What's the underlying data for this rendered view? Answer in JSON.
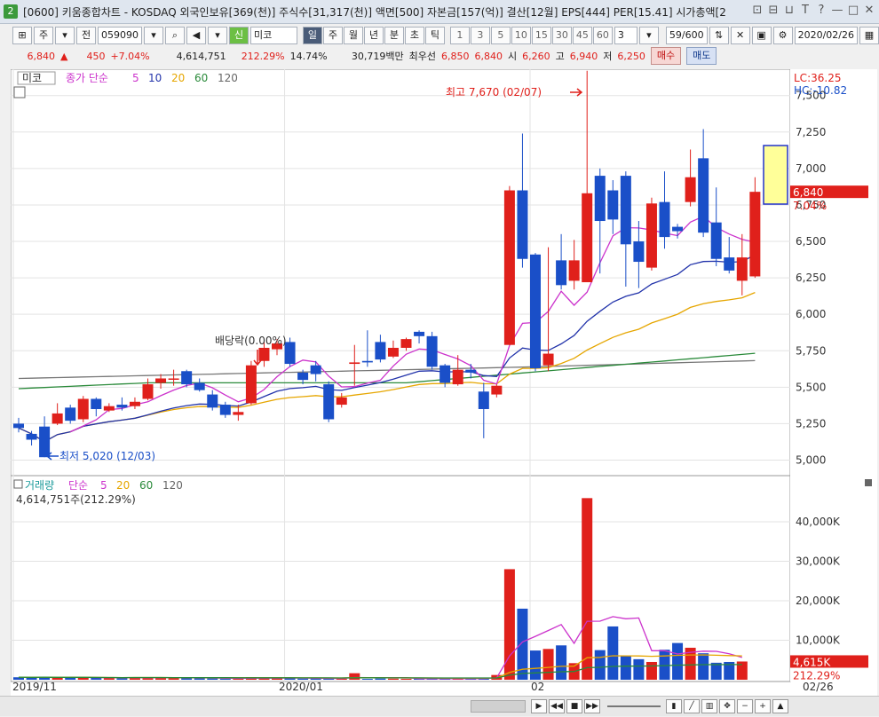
{
  "window": {
    "number": "2",
    "title": "[0600] 키움종합차트 - KOSDAQ 외국인보유[369(천)] 주식수[31,317(천)] 액면[500] 자본금[157(억)] 결산[12월] EPS[444] PER[15.41] 시가총액[2",
    "controls": [
      "⊡",
      "⊟",
      "⊔",
      "T",
      "?",
      "—",
      "□",
      "✕"
    ]
  },
  "toolbar": {
    "kind": "주",
    "prev_label": "전",
    "code": "059090",
    "credit_label": "신",
    "name": "미코",
    "periods": [
      "일",
      "주",
      "월",
      "년",
      "분",
      "초",
      "틱"
    ],
    "period_selected": "일",
    "intervals": [
      "1",
      "3",
      "5",
      "10",
      "15",
      "30",
      "45",
      "60"
    ],
    "interval_value": "3",
    "count": "59/600",
    "date": "2020/02/26"
  },
  "quote": {
    "price": "6,840",
    "arrow": "▲",
    "change": "450",
    "change_pct": "+7.04%",
    "volume": "4,614,751",
    "volume_ratio": "212.29%",
    "turnover": "14.74%",
    "amount": "30,719백만",
    "best_ask_label": "최우선",
    "best_ask": "6,850",
    "best_bid": "6,840",
    "open_label": "시",
    "open": "6,260",
    "high_label": "고",
    "high": "6,940",
    "low_label": "저",
    "low": "6,250",
    "buy_label": "매수",
    "sell_label": "매도"
  },
  "price_panel": {
    "name_tag": "미코",
    "legend": [
      "종가 단순",
      "5",
      "10",
      "20",
      "60",
      "120"
    ],
    "legend_colors": [
      "#cc33cc",
      "#cc33cc",
      "#2233aa",
      "#e6a600",
      "#2a8a3a",
      "#666666"
    ],
    "lc": "LC:36.25",
    "hc": "HC:-10.82",
    "high_annot": "최고 7,670 (02/07)",
    "low_annot": "최저 5,020 (12/03)",
    "div_annot": "배당락(0.00%)",
    "last_price_tag": "6,840",
    "last_pct_tag": "7.04%",
    "y_ticks": [
      "7,500",
      "7,250",
      "7,000",
      "6,750",
      "6,500",
      "6,250",
      "6,000",
      "5,750",
      "5,500",
      "5,250",
      "5,000"
    ]
  },
  "volume_panel": {
    "legend": [
      "거래량",
      "단순",
      "5",
      "20",
      "60",
      "120"
    ],
    "legend_colors": [
      "#1a9a9a",
      "#cc33cc",
      "#cc33cc",
      "#e6a600",
      "#2a8a3a",
      "#666666"
    ],
    "current": "4,614,751주(212.29%)",
    "last_tag": "4,615K",
    "last_pct": "212.29%",
    "y_ticks": [
      "40,000K",
      "30,000K",
      "20,000K",
      "10,000K"
    ]
  },
  "x_axis": [
    "2019/11",
    "2020/01",
    "02",
    "02/26"
  ],
  "candles": [
    [
      5250,
      5220,
      5290,
      5190
    ],
    [
      5180,
      5140,
      5200,
      5100
    ],
    [
      5230,
      5020,
      5300,
      5020
    ],
    [
      5250,
      5320,
      5390,
      5240
    ],
    [
      5360,
      5270,
      5380,
      5250
    ],
    [
      5280,
      5420,
      5440,
      5260
    ],
    [
      5420,
      5350,
      5430,
      5300
    ],
    [
      5340,
      5370,
      5390,
      5330
    ],
    [
      5380,
      5360,
      5430,
      5340
    ],
    [
      5370,
      5400,
      5430,
      5350
    ],
    [
      5420,
      5520,
      5560,
      5410
    ],
    [
      5530,
      5560,
      5590,
      5490
    ],
    [
      5560,
      5560,
      5620,
      5510
    ],
    [
      5610,
      5520,
      5620,
      5500
    ],
    [
      5530,
      5480,
      5560,
      5470
    ],
    [
      5450,
      5360,
      5480,
      5340
    ],
    [
      5380,
      5310,
      5400,
      5290
    ],
    [
      5310,
      5330,
      5380,
      5270
    ],
    [
      5390,
      5650,
      5680,
      5380
    ],
    [
      5680,
      5770,
      5810,
      5640
    ],
    [
      5760,
      5800,
      5830,
      5720
    ],
    [
      5810,
      5660,
      5840,
      5640
    ],
    [
      5600,
      5550,
      5620,
      5520
    ],
    [
      5650,
      5590,
      5680,
      5540
    ],
    [
      5520,
      5280,
      5540,
      5260
    ],
    [
      5380,
      5430,
      5460,
      5360
    ],
    [
      5660,
      5670,
      5790,
      5510
    ],
    [
      5680,
      5670,
      5890,
      5640
    ],
    [
      5810,
      5690,
      5860,
      5670
    ],
    [
      5710,
      5770,
      5820,
      5700
    ],
    [
      5770,
      5830,
      5840,
      5750
    ],
    [
      5880,
      5850,
      5890,
      5800
    ],
    [
      5850,
      5640,
      5880,
      5620
    ],
    [
      5650,
      5530,
      5660,
      5500
    ],
    [
      5520,
      5620,
      5720,
      5510
    ],
    [
      5620,
      5600,
      5660,
      5560
    ],
    [
      5470,
      5350,
      5530,
      5150
    ],
    [
      5450,
      5510,
      5520,
      5430
    ],
    [
      5790,
      6850,
      6880,
      5790
    ],
    [
      6850,
      6380,
      7240,
      6320
    ],
    [
      6410,
      5630,
      6420,
      5610
    ],
    [
      5650,
      5730,
      6460,
      5610
    ],
    [
      6370,
      6200,
      6550,
      6170
    ],
    [
      6230,
      6370,
      6510,
      6170
    ],
    [
      6220,
      6830,
      7670,
      6220
    ],
    [
      6950,
      6640,
      7000,
      6280
    ],
    [
      6850,
      6650,
      6920,
      6550
    ],
    [
      6950,
      6480,
      6980,
      6190
    ],
    [
      6500,
      6360,
      6640,
      6180
    ],
    [
      6320,
      6760,
      6800,
      6300
    ],
    [
      6770,
      6530,
      6980,
      6450
    ],
    [
      6600,
      6570,
      6620,
      6520
    ],
    [
      6770,
      6940,
      7130,
      6740
    ],
    [
      7070,
      6560,
      7270,
      6530
    ],
    [
      6630,
      6380,
      6870,
      6330
    ],
    [
      6390,
      6300,
      6530,
      6280
    ],
    [
      6230,
      6390,
      6550,
      6130
    ],
    [
      6260,
      6840,
      6940,
      6250
    ]
  ],
  "volumes": [
    620,
    580,
    700,
    520,
    560,
    610,
    450,
    480,
    430,
    590,
    520,
    610,
    480,
    470,
    360,
    320,
    300,
    280,
    660,
    410,
    390,
    380,
    290,
    320,
    300,
    250,
    1650,
    220,
    300,
    280,
    250,
    260,
    290,
    260,
    270,
    230,
    400,
    1200,
    28000,
    18000,
    7400,
    7800,
    8700,
    4200,
    46000,
    7500,
    13500,
    6000,
    5200,
    4500,
    7600,
    9300,
    8100,
    6700,
    4300,
    4500,
    4615
  ]
}
